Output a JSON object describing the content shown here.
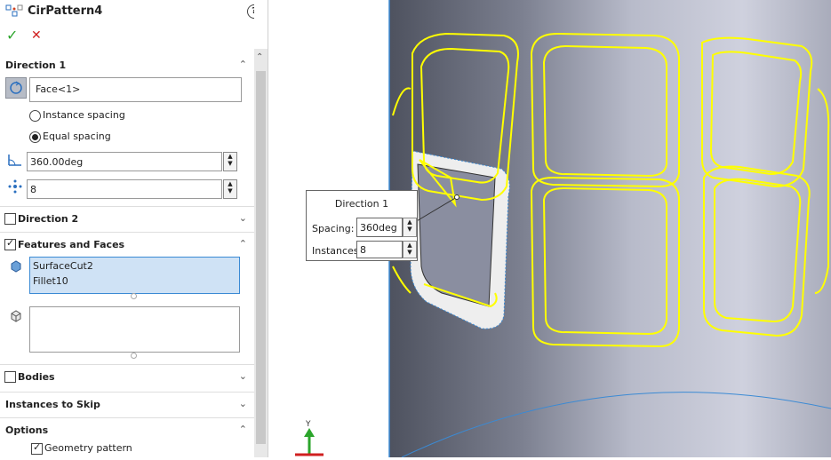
{
  "feature": {
    "title": "CirPattern4",
    "help_icon": "?"
  },
  "actions": {
    "ok": "✓",
    "cancel": "✕"
  },
  "direction1": {
    "label": "Direction 1",
    "axis_value": "Face<1>",
    "instance_spacing": "Instance spacing",
    "equal_spacing": "Equal spacing",
    "angle": "360.00deg",
    "instances": "8"
  },
  "direction2": {
    "label": "Direction 2"
  },
  "features_faces": {
    "label": "Features and Faces",
    "items": [
      "SurfaceCut2",
      "Fillet10"
    ]
  },
  "bodies": {
    "label": "Bodies"
  },
  "instances_to_skip": {
    "label": "Instances to Skip"
  },
  "options": {
    "label": "Options",
    "geometry_pattern": "Geometry pattern"
  },
  "callout": {
    "title": "Direction 1",
    "spacing_label": "Spacing:",
    "spacing_value": "360deg",
    "instances_label": "Instances:",
    "instances_value": "8"
  },
  "colors": {
    "accent": "#3b8ad4",
    "highlight": "#ffff00",
    "body_dark": "#5d6170",
    "body_light": "#c9cbd9"
  }
}
